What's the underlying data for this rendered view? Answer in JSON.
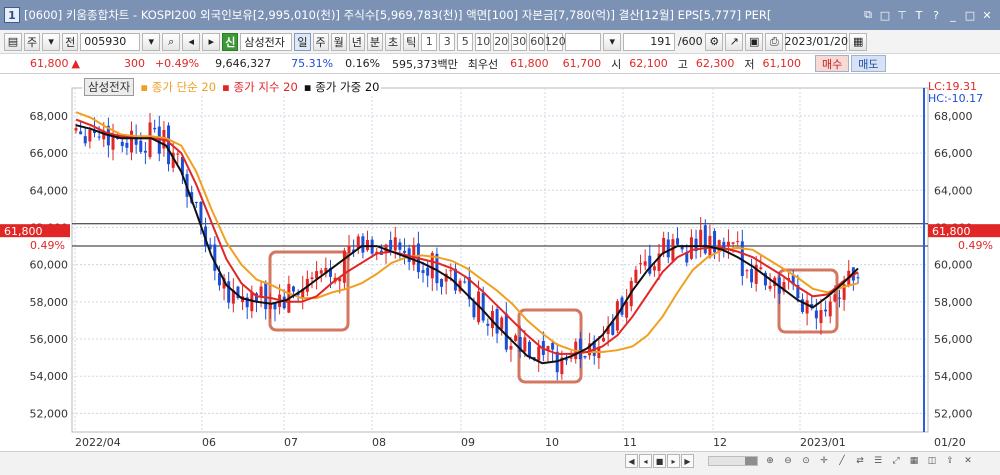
{
  "window": {
    "number": "1",
    "title": "[0600] 키움종합차트 - KOSPI200 외국인보유[2,995,010(천)] 주식수[5,969,783(천)] 액면[100] 자본금[7,780(억)] 결산[12월] EPS[5,777] PER[",
    "icons": [
      "restore-icon",
      "window-icon",
      "pin-icon",
      "text-icon",
      "help-icon",
      "minimize-icon",
      "maximize-icon",
      "close-icon"
    ],
    "icon_glyphs": [
      "⧉",
      "□",
      "⊤",
      "T",
      "?",
      "_",
      "□",
      "✕"
    ]
  },
  "toolbar": {
    "period_week": "주",
    "period_all": "전",
    "code": "005930",
    "stock_badge": "신",
    "stock_name": "삼성전자",
    "tf_day": "일",
    "tf_week": "주",
    "tf_month": "월",
    "tf_year": "년",
    "tf_minute": "분",
    "tf_second": "초",
    "tf_tick": "틱",
    "intervals": [
      "1",
      "3",
      "5",
      "10",
      "20",
      "30",
      "60",
      "120"
    ],
    "count": "191",
    "total": "/600",
    "date": "2023/01/20"
  },
  "quote": {
    "price": "61,800",
    "change": "300",
    "change_pct": "+0.49%",
    "volume": "9,646,327",
    "vol_ratio": "75.31%",
    "turnover": "0.16%",
    "amount": "595,373백만",
    "best_label": "최우선",
    "best_ask": "61,800",
    "best_bid": "61,700",
    "open_label": "시",
    "open": "62,100",
    "high_label": "고",
    "high": "62,300",
    "low_label": "저",
    "low": "61,100",
    "buy_label": "매수",
    "sell_label": "매도"
  },
  "legend": {
    "stock": "삼성전자",
    "ma_simple": "종가 단순 20",
    "ma_exp": "종가 지수 20",
    "ma_weighted": "종가 가중 20"
  },
  "labels": {
    "lc": "LC:19.31",
    "hc": "HC:-10.17",
    "current_price": "61,800",
    "current_pct": "0.49%",
    "bottom_right": "01/20"
  },
  "colors": {
    "up": "#e12626",
    "down": "#1c4fd6",
    "ma_simple": "#f0a020",
    "ma_exp": "#e12626",
    "ma_weighted": "#111111",
    "highlight": "#d47760"
  },
  "chart_data": {
    "type": "candlestick",
    "series": [
      {
        "name": "종가 단순 20",
        "values": [
          68200,
          67900,
          67400,
          67000,
          66900,
          66900,
          66800,
          66400,
          65000,
          63000,
          61200,
          60000,
          59200,
          58900,
          58500,
          58200,
          58200,
          58500,
          58700,
          59000,
          59500,
          60100,
          60400,
          60500,
          60400,
          60200,
          59800,
          59200,
          58600,
          57900,
          57000,
          56300,
          55700,
          55400,
          55300,
          55300,
          55400,
          55600,
          56200,
          57200,
          58500,
          59700,
          60400,
          60800,
          60900,
          60800,
          60300,
          59800,
          59300,
          58700,
          58500,
          58800,
          59000
        ]
      },
      {
        "name": "종가 지수 20",
        "values": [
          67800,
          67500,
          67100,
          66900,
          66800,
          66800,
          66700,
          66000,
          64300,
          62300,
          60300,
          59000,
          58300,
          58200,
          58000,
          58000,
          58300,
          59000,
          59600,
          60100,
          60600,
          60700,
          60500,
          60300,
          60100,
          59800,
          59300,
          58600,
          57800,
          57000,
          56200,
          55500,
          55200,
          55200,
          55300,
          55600,
          56200,
          57200,
          58400,
          59600,
          60400,
          60800,
          60900,
          60900,
          60700,
          60400,
          59900,
          59400,
          58800,
          58300,
          58400,
          59100,
          59600
        ]
      },
      {
        "name": "종가 가중 20",
        "values": [
          67500,
          67300,
          67000,
          66800,
          66800,
          66800,
          66400,
          65000,
          62800,
          60500,
          58900,
          58200,
          58000,
          57900,
          58100,
          58600,
          59200,
          59800,
          60400,
          61000,
          61000,
          60700,
          60400,
          60100,
          59700,
          59200,
          58400,
          57600,
          56700,
          55900,
          55100,
          54700,
          54800,
          55100,
          55500,
          56200,
          57300,
          58600,
          59700,
          60600,
          61000,
          61000,
          61000,
          60800,
          60400,
          59900,
          59300,
          58700,
          58100,
          57700,
          58300,
          59000,
          59800
        ]
      }
    ],
    "x_labels": [
      "2022/04",
      "06",
      "07",
      "08",
      "09",
      "10",
      "11",
      "12",
      "2023/01"
    ],
    "y_ticks": [
      "52,000",
      "54,000",
      "56,000",
      "58,000",
      "60,000",
      "62,000",
      "64,000",
      "66,000",
      "68,000"
    ],
    "ylim": [
      51000,
      69500
    ],
    "reference_lines": [
      62200,
      61000
    ],
    "highlight_ranges": [
      "2022/06",
      "2022/09-10",
      "2022/12-2023/01"
    ],
    "last_close": 61800
  }
}
